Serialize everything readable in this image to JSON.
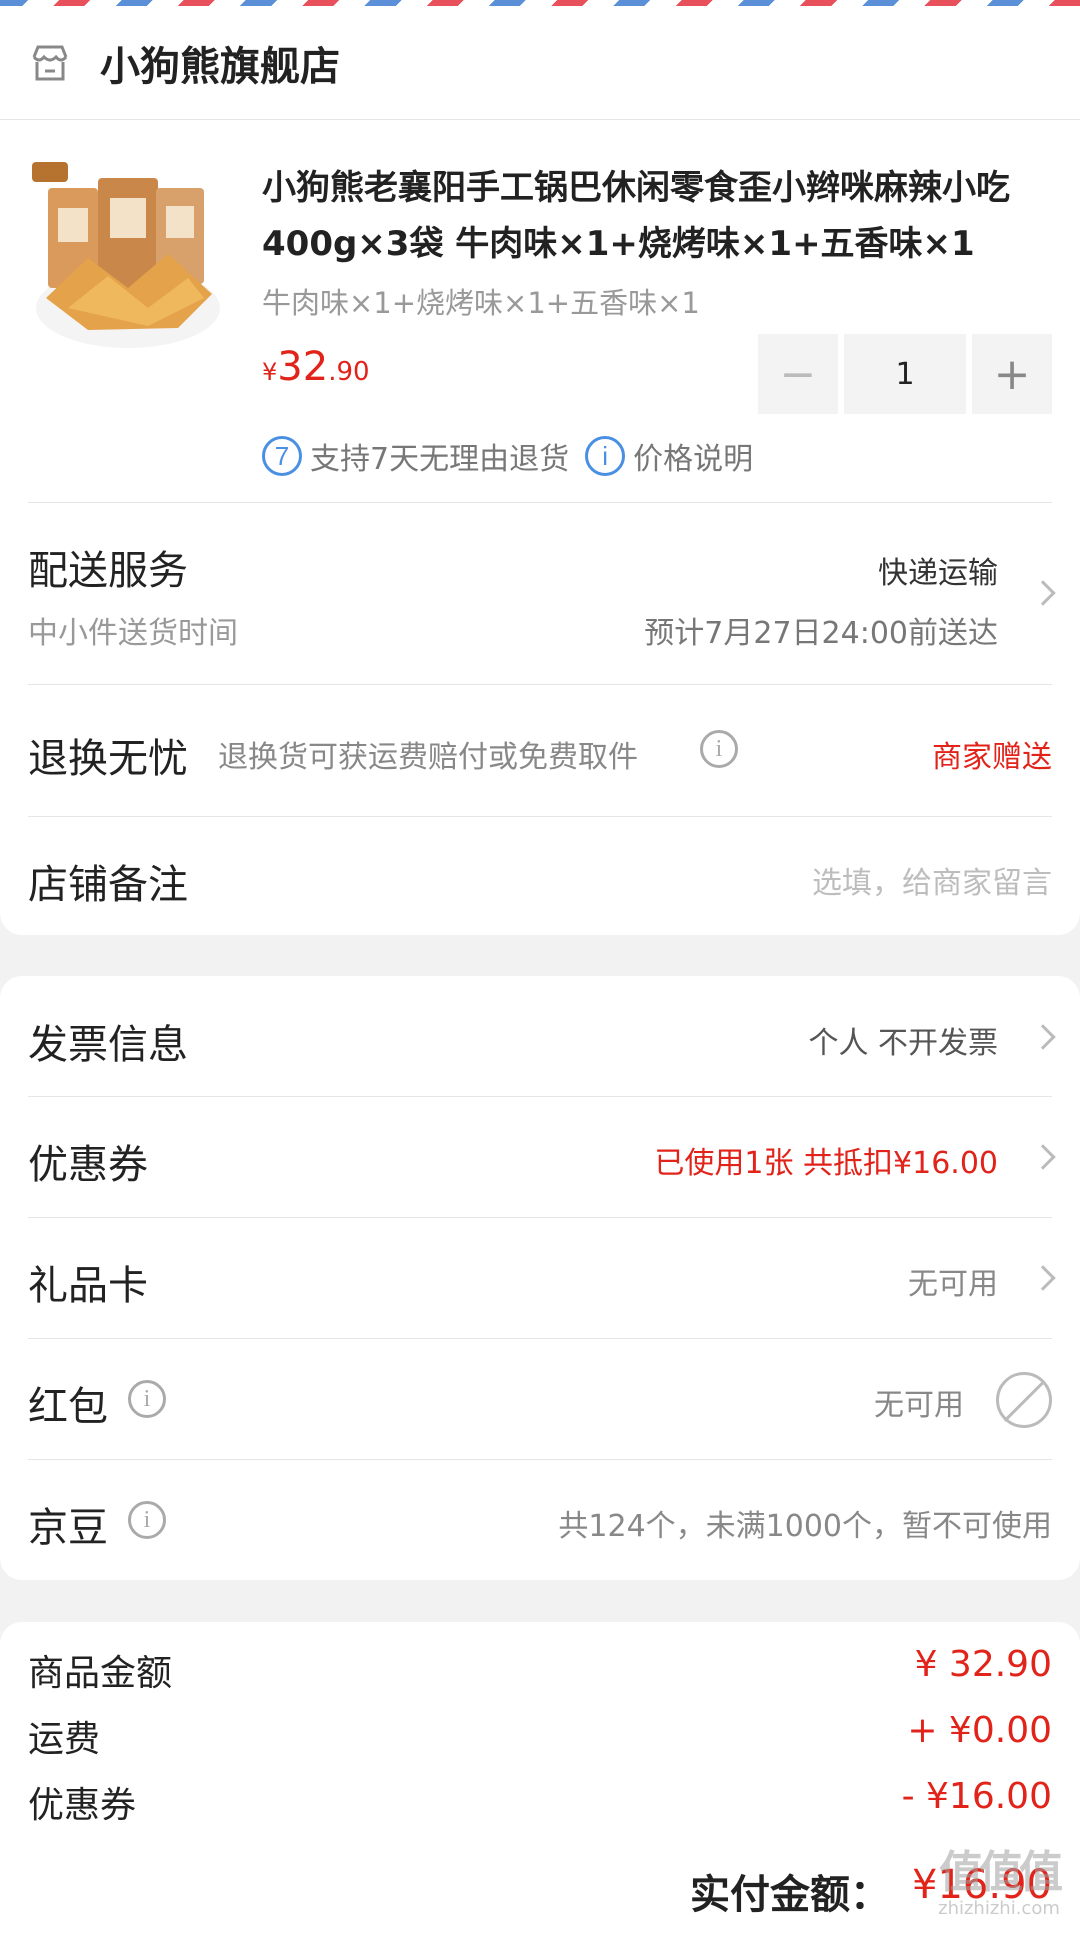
{
  "store": {
    "name": "小狗熊旗舰店",
    "icon": "store-icon"
  },
  "product": {
    "title": "小狗熊老襄阳手工锅巴休闲零食歪小辫咪麻辣小吃400g×3袋 牛肉味×1+烧烤味×1+五香味×1",
    "spec": "牛肉味×1+烧烤味×1+五香味×1",
    "price_symbol": "¥",
    "price_int": "32",
    "price_dec": ".90",
    "quantity": "1",
    "minus": "−",
    "plus": "+",
    "tag_return_icon": "7",
    "tag_return": "支持7天无理由退货",
    "tag_price_icon": "i",
    "tag_price": "价格说明"
  },
  "delivery": {
    "title": "配送服务",
    "subtitle": "中小件送货时间",
    "method": "快递运输",
    "eta": "预计7月27日24:00前送达"
  },
  "return_service": {
    "title": "退换无忧",
    "desc": "退换货可获运费赔付或免费取件",
    "value": "商家赠送"
  },
  "note": {
    "title": "店铺备注",
    "placeholder": "选填，给商家留言"
  },
  "invoice": {
    "title": "发票信息",
    "value": "个人 不开发票"
  },
  "coupon": {
    "title": "优惠券",
    "value": "已使用1张 共抵扣¥16.00"
  },
  "gift_card": {
    "title": "礼品卡",
    "value": "无可用"
  },
  "red_packet": {
    "title": "红包",
    "value": "无可用"
  },
  "jingdou": {
    "title": "京豆",
    "value": "共124个，未满1000个，暂不可使用"
  },
  "summary": {
    "goods_label": "商品金额",
    "goods_value": "¥ 32.90",
    "shipping_label": "运费",
    "shipping_value": "+ ¥0.00",
    "coupon_label": "优惠券",
    "coupon_value": "- ¥16.00",
    "total_label": "实付金额：",
    "total_value": "¥16.90"
  },
  "watermark": {
    "big": "值值值",
    "small": "zhizhizhi.com"
  },
  "colors": {
    "accent": "#e2231a",
    "info_blue": "#4a90e2"
  }
}
